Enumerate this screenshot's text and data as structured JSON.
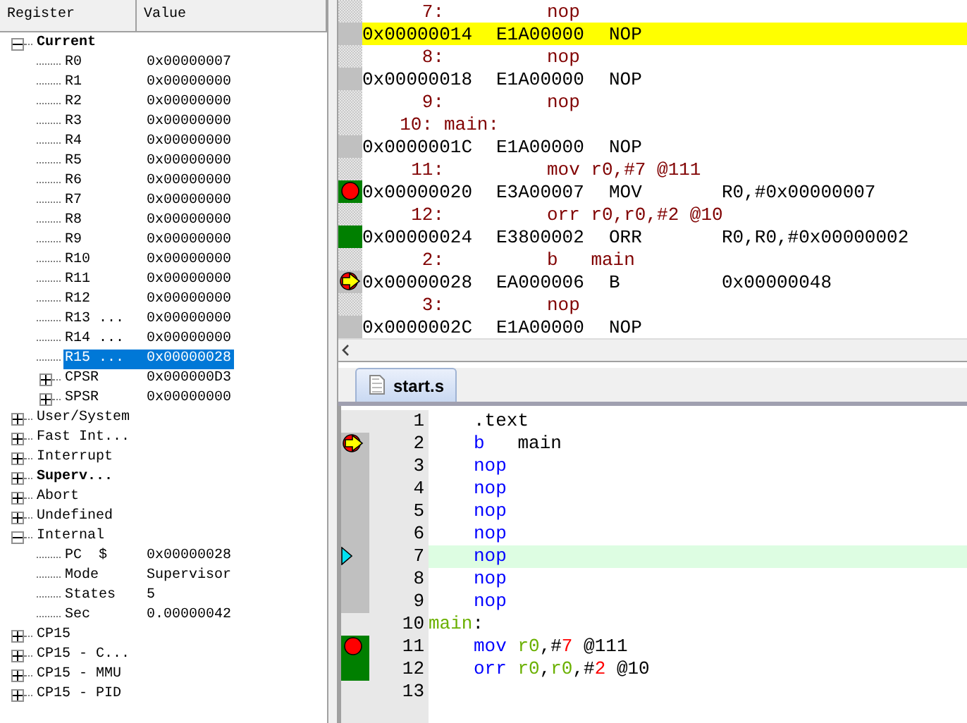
{
  "registers": {
    "columns": [
      "Register",
      "Value"
    ],
    "groups": [
      {
        "name": "Current",
        "bold": true,
        "expanded": true,
        "selected": false,
        "children": [
          {
            "name": "R0",
            "value": "0x00000007",
            "selected": false
          },
          {
            "name": "R1",
            "value": "0x00000000",
            "selected": false
          },
          {
            "name": "R2",
            "value": "0x00000000",
            "selected": false
          },
          {
            "name": "R3",
            "value": "0x00000000",
            "selected": false
          },
          {
            "name": "R4",
            "value": "0x00000000",
            "selected": false
          },
          {
            "name": "R5",
            "value": "0x00000000",
            "selected": false
          },
          {
            "name": "R6",
            "value": "0x00000000",
            "selected": false
          },
          {
            "name": "R7",
            "value": "0x00000000",
            "selected": false
          },
          {
            "name": "R8",
            "value": "0x00000000",
            "selected": false
          },
          {
            "name": "R9",
            "value": "0x00000000",
            "selected": false
          },
          {
            "name": "R10",
            "value": "0x00000000",
            "selected": false
          },
          {
            "name": "R11",
            "value": "0x00000000",
            "selected": false
          },
          {
            "name": "R12",
            "value": "0x00000000",
            "selected": false
          },
          {
            "name": "R13 ...",
            "value": "0x00000000",
            "selected": false
          },
          {
            "name": "R14 ...",
            "value": "0x00000000",
            "selected": false
          },
          {
            "name": "R15 ...",
            "value": "0x00000028",
            "selected": true
          },
          {
            "name": "CPSR",
            "value": "0x000000D3",
            "expanded": false,
            "selected": false
          },
          {
            "name": "SPSR",
            "value": "0x00000000",
            "expanded": false,
            "selected": false
          }
        ]
      },
      {
        "name": "User/System",
        "bold": false,
        "expanded": false,
        "selected": false
      },
      {
        "name": "Fast Int...",
        "bold": false,
        "expanded": false,
        "selected": false
      },
      {
        "name": "Interrupt",
        "bold": false,
        "expanded": false,
        "selected": false
      },
      {
        "name": "Superv...",
        "bold": true,
        "expanded": false,
        "selected": false
      },
      {
        "name": "Abort",
        "bold": false,
        "expanded": false,
        "selected": false
      },
      {
        "name": "Undefined",
        "bold": false,
        "expanded": false,
        "selected": false
      },
      {
        "name": "Internal",
        "bold": false,
        "expanded": true,
        "selected": false,
        "children": [
          {
            "name": "PC  $",
            "value": "0x00000028",
            "selected": false
          },
          {
            "name": "Mode",
            "value": "Supervisor",
            "selected": false
          },
          {
            "name": "States",
            "value": "5",
            "selected": false
          },
          {
            "name": "Sec",
            "value": "0.00000042",
            "selected": false
          }
        ]
      },
      {
        "name": "CP15",
        "bold": false,
        "expanded": false,
        "selected": false
      },
      {
        "name": "CP15 - C...",
        "bold": false,
        "expanded": false,
        "selected": false
      },
      {
        "name": "CP15 - MMU",
        "bold": false,
        "expanded": false,
        "selected": false
      },
      {
        "name": "CP15 - PID",
        "bold": false,
        "expanded": false,
        "selected": false
      }
    ]
  },
  "disassembly": [
    {
      "kind": "source",
      "line": "7:",
      "code": "nop"
    },
    {
      "kind": "asm",
      "address": "0x00000014",
      "opcode": "E1A00000",
      "mnemonic": "NOP",
      "highlighted": true,
      "executed": false,
      "breakpoint": false,
      "current": false
    },
    {
      "kind": "source",
      "line": "8:",
      "code": "nop"
    },
    {
      "kind": "asm",
      "address": "0x00000018",
      "opcode": "E1A00000",
      "mnemonic": "NOP",
      "highlighted": false,
      "executed": false,
      "breakpoint": false,
      "current": false
    },
    {
      "kind": "source",
      "line": "9:",
      "code": "nop"
    },
    {
      "kind": "label",
      "line": "10:",
      "code": "main:"
    },
    {
      "kind": "asm",
      "address": "0x0000001C",
      "opcode": "E1A00000",
      "mnemonic": "NOP",
      "highlighted": false,
      "executed": false,
      "breakpoint": false,
      "current": false
    },
    {
      "kind": "source",
      "line": "11:",
      "code": "mov r0,#7 @111"
    },
    {
      "kind": "asm",
      "address": "0x00000020",
      "opcode": "E3A00007",
      "mnemonic": "MOV",
      "operands": "R0,#0x00000007",
      "highlighted": false,
      "executed": true,
      "breakpoint": true,
      "current": false
    },
    {
      "kind": "source",
      "line": "12:",
      "code": "orr r0,r0,#2 @10"
    },
    {
      "kind": "asm",
      "address": "0x00000024",
      "opcode": "E3800002",
      "mnemonic": "ORR",
      "operands": "R0,R0,#0x00000002",
      "highlighted": false,
      "executed": true,
      "breakpoint": false,
      "current": false
    },
    {
      "kind": "source",
      "line": "2:",
      "code": "b   main"
    },
    {
      "kind": "asm",
      "address": "0x00000028",
      "opcode": "EA000006",
      "mnemonic": "B",
      "operands": "0x00000048",
      "highlighted": false,
      "executed": false,
      "breakpoint": true,
      "current": true
    },
    {
      "kind": "source",
      "line": "3:",
      "code": "nop"
    },
    {
      "kind": "asm",
      "address": "0x0000002C",
      "opcode": "E1A00000",
      "mnemonic": "NOP",
      "highlighted": false,
      "executed": false,
      "breakpoint": false,
      "current": false
    }
  ],
  "editor": {
    "tabs": [
      {
        "label": "start.s",
        "selected": true
      }
    ],
    "lines": [
      {
        "number": "1",
        "kind": "instruction",
        "highlighted": false,
        "breakpoint": false,
        "current": false,
        "cursor": false,
        "tokens": [
          {
            "text": ".text",
            "kind": "plain"
          }
        ]
      },
      {
        "number": "2",
        "kind": "instruction",
        "highlighted": false,
        "executed": false,
        "breakpoint": true,
        "current": true,
        "cursor": false,
        "tokens": [
          {
            "text": "b",
            "kind": "keyword"
          },
          {
            "text": "   main",
            "kind": "plain"
          }
        ]
      },
      {
        "number": "3",
        "kind": "instruction",
        "highlighted": false,
        "executed": false,
        "breakpoint": false,
        "current": false,
        "cursor": false,
        "tokens": [
          {
            "text": "nop",
            "kind": "keyword"
          }
        ]
      },
      {
        "number": "4",
        "kind": "instruction",
        "highlighted": false,
        "executed": false,
        "breakpoint": false,
        "current": false,
        "cursor": false,
        "tokens": [
          {
            "text": "nop",
            "kind": "keyword"
          }
        ]
      },
      {
        "number": "5",
        "kind": "instruction",
        "highlighted": false,
        "executed": false,
        "breakpoint": false,
        "current": false,
        "cursor": false,
        "tokens": [
          {
            "text": "nop",
            "kind": "keyword"
          }
        ]
      },
      {
        "number": "6",
        "kind": "instruction",
        "highlighted": false,
        "executed": false,
        "breakpoint": false,
        "current": false,
        "cursor": false,
        "tokens": [
          {
            "text": "nop",
            "kind": "keyword"
          }
        ]
      },
      {
        "number": "7",
        "kind": "instruction",
        "highlighted": true,
        "executed": false,
        "breakpoint": false,
        "current": false,
        "cursor": true,
        "tokens": [
          {
            "text": "nop",
            "kind": "keyword"
          }
        ]
      },
      {
        "number": "8",
        "kind": "instruction",
        "highlighted": false,
        "executed": false,
        "breakpoint": false,
        "current": false,
        "cursor": false,
        "tokens": [
          {
            "text": "nop",
            "kind": "keyword"
          }
        ]
      },
      {
        "number": "9",
        "kind": "instruction",
        "highlighted": false,
        "executed": false,
        "breakpoint": false,
        "current": false,
        "cursor": false,
        "tokens": [
          {
            "text": "nop",
            "kind": "keyword"
          }
        ]
      },
      {
        "number": "10",
        "kind": "label",
        "highlighted": false,
        "breakpoint": false,
        "current": false,
        "cursor": false,
        "tokens": [
          {
            "text": "main",
            "kind": "label"
          },
          {
            "text": ":",
            "kind": "plain"
          }
        ]
      },
      {
        "number": "11",
        "kind": "instruction",
        "highlighted": false,
        "executed": true,
        "breakpoint": true,
        "current": false,
        "cursor": false,
        "tokens": [
          {
            "text": "mov",
            "kind": "keyword"
          },
          {
            "text": " r0",
            "kind": "register"
          },
          {
            "text": ",#",
            "kind": "plain"
          },
          {
            "text": "7",
            "kind": "number"
          },
          {
            "text": " @111",
            "kind": "plain"
          }
        ]
      },
      {
        "number": "12",
        "kind": "instruction",
        "highlighted": false,
        "executed": true,
        "breakpoint": false,
        "current": false,
        "cursor": false,
        "tokens": [
          {
            "text": "orr",
            "kind": "keyword"
          },
          {
            "text": " r0",
            "kind": "register"
          },
          {
            "text": ",",
            "kind": "plain"
          },
          {
            "text": "r0",
            "kind": "register"
          },
          {
            "text": ",#",
            "kind": "plain"
          },
          {
            "text": "2",
            "kind": "number"
          },
          {
            "text": " @10",
            "kind": "plain"
          }
        ]
      },
      {
        "number": "13",
        "kind": "blank",
        "breakpoint": false,
        "current": false,
        "cursor": false
      }
    ]
  }
}
